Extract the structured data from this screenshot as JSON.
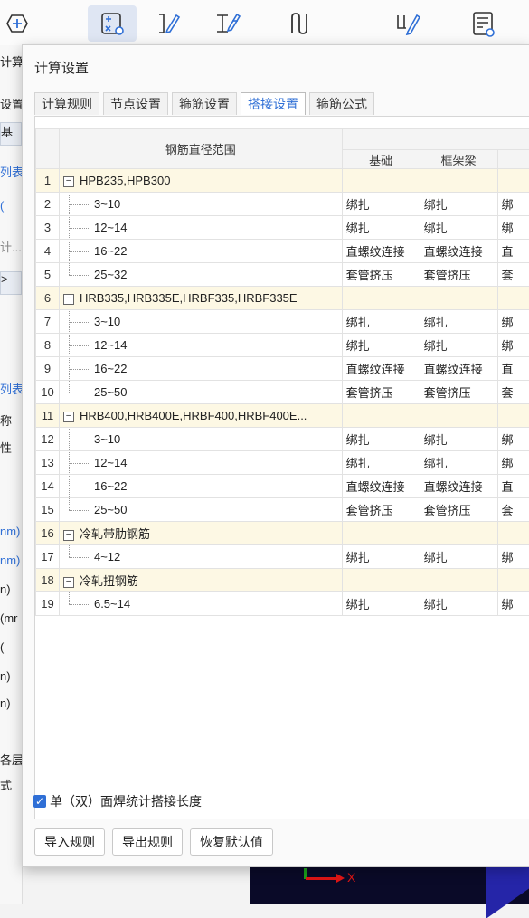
{
  "toolbar": {
    "buttons": [
      {
        "icon": "add-circle-icon"
      },
      {
        "icon": "calc-settings-icon"
      },
      {
        "icon": "rebar-edit-icon"
      },
      {
        "icon": "section-edit-icon"
      },
      {
        "icon": "lap-joint-icon"
      },
      {
        "icon": "rebar-pen-icon"
      },
      {
        "icon": "report-settings-icon"
      }
    ]
  },
  "left_panel": {
    "items": [
      "计算",
      "设置",
      "基",
      "列表",
      "(",
      "计...",
      ">",
      "列表",
      "称",
      "性",
      "nm)",
      "nm)",
      "n)",
      "(mr",
      "(",
      "n)",
      "n)",
      "各层",
      "式"
    ]
  },
  "canvas": {
    "axis_label": "X"
  },
  "dialog": {
    "title": "计算设置",
    "tabs": [
      "计算规则",
      "节点设置",
      "箍筋设置",
      "搭接设置",
      "箍筋公式"
    ],
    "active_tab": "搭接设置",
    "table": {
      "header_main": "钢筋直径范围",
      "header_sub": [
        "基础",
        "框架梁"
      ],
      "rows": [
        {
          "n": "1",
          "label": "HPB235,HPB300",
          "group": true,
          "c1": "",
          "c2": "",
          "c3": ""
        },
        {
          "n": "2",
          "label": "3~10",
          "c1": "绑扎",
          "c2": "绑扎",
          "c3": "绑"
        },
        {
          "n": "3",
          "label": "12~14",
          "c1": "绑扎",
          "c2": "绑扎",
          "c3": "绑"
        },
        {
          "n": "4",
          "label": "16~22",
          "c1": "直螺纹连接",
          "c2": "直螺纹连接",
          "c3": "直"
        },
        {
          "n": "5",
          "label": "25~32",
          "c1": "套管挤压",
          "c2": "套管挤压",
          "c3": "套",
          "last": true
        },
        {
          "n": "6",
          "label": "HRB335,HRB335E,HRBF335,HRBF335E",
          "group": true,
          "c1": "",
          "c2": "",
          "c3": ""
        },
        {
          "n": "7",
          "label": "3~10",
          "c1": "绑扎",
          "c2": "绑扎",
          "c3": "绑"
        },
        {
          "n": "8",
          "label": "12~14",
          "c1": "绑扎",
          "c2": "绑扎",
          "c3": "绑"
        },
        {
          "n": "9",
          "label": "16~22",
          "c1": "直螺纹连接",
          "c2": "直螺纹连接",
          "c3": "直"
        },
        {
          "n": "10",
          "label": "25~50",
          "c1": "套管挤压",
          "c2": "套管挤压",
          "c3": "套",
          "last": true
        },
        {
          "n": "11",
          "label": "HRB400,HRB400E,HRBF400,HRBF400E...",
          "group": true,
          "c1": "",
          "c2": "",
          "c3": ""
        },
        {
          "n": "12",
          "label": "3~10",
          "c1": "绑扎",
          "c2": "绑扎",
          "c3": "绑"
        },
        {
          "n": "13",
          "label": "12~14",
          "c1": "绑扎",
          "c2": "绑扎",
          "c3": "绑"
        },
        {
          "n": "14",
          "label": "16~22",
          "c1": "直螺纹连接",
          "c2": "直螺纹连接",
          "c3": "直"
        },
        {
          "n": "15",
          "label": "25~50",
          "c1": "套管挤压",
          "c2": "套管挤压",
          "c3": "套",
          "last": true
        },
        {
          "n": "16",
          "label": "冷轧带肋钢筋",
          "group": true,
          "c1": "",
          "c2": "",
          "c3": ""
        },
        {
          "n": "17",
          "label": "4~12",
          "c1": "绑扎",
          "c2": "绑扎",
          "c3": "绑",
          "last": true
        },
        {
          "n": "18",
          "label": "冷轧扭钢筋",
          "group": true,
          "c1": "",
          "c2": "",
          "c3": ""
        },
        {
          "n": "19",
          "label": "6.5~14",
          "c1": "绑扎",
          "c2": "绑扎",
          "c3": "绑",
          "last": true
        }
      ]
    },
    "checkbox": {
      "label": "单（双）面焊统计搭接长度",
      "checked": true
    },
    "buttons": [
      "导入规则",
      "导出规则",
      "恢复默认值"
    ]
  }
}
